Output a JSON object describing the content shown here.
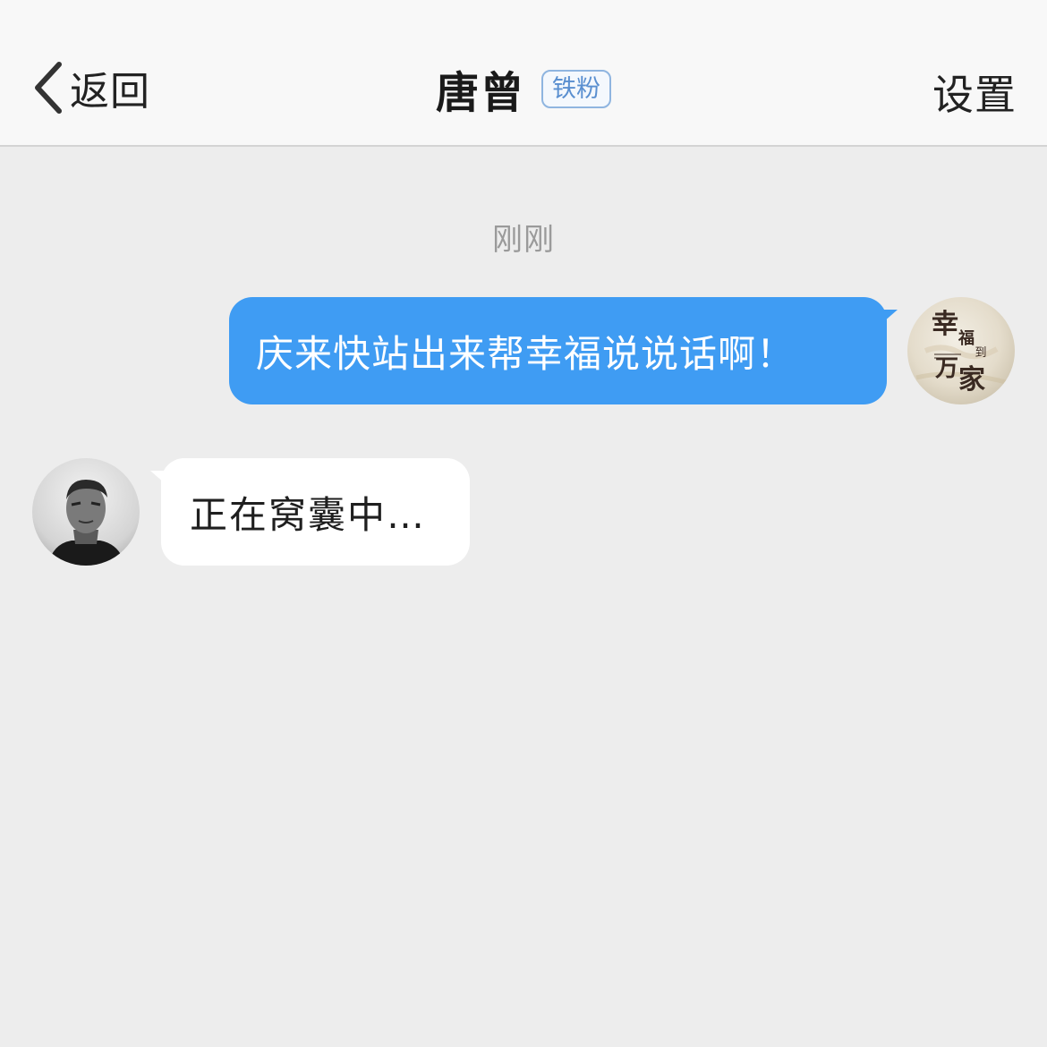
{
  "header": {
    "back_label": "返回",
    "title": "唐曾",
    "badge": "铁粉",
    "settings_label": "设置"
  },
  "chat": {
    "timestamp": "刚刚",
    "messages": [
      {
        "direction": "outgoing",
        "text": "庆来快站出来帮幸福说说话啊！",
        "avatar_logo": "幸福到万家"
      },
      {
        "direction": "incoming",
        "text": "正在窝囊中…"
      }
    ]
  },
  "colors": {
    "outgoing_bubble": "#3f9cf3",
    "incoming_bubble": "#ffffff",
    "background": "#ededed",
    "badge": "#5a8fd0"
  },
  "icons": {
    "back": "chevron-left-icon"
  }
}
